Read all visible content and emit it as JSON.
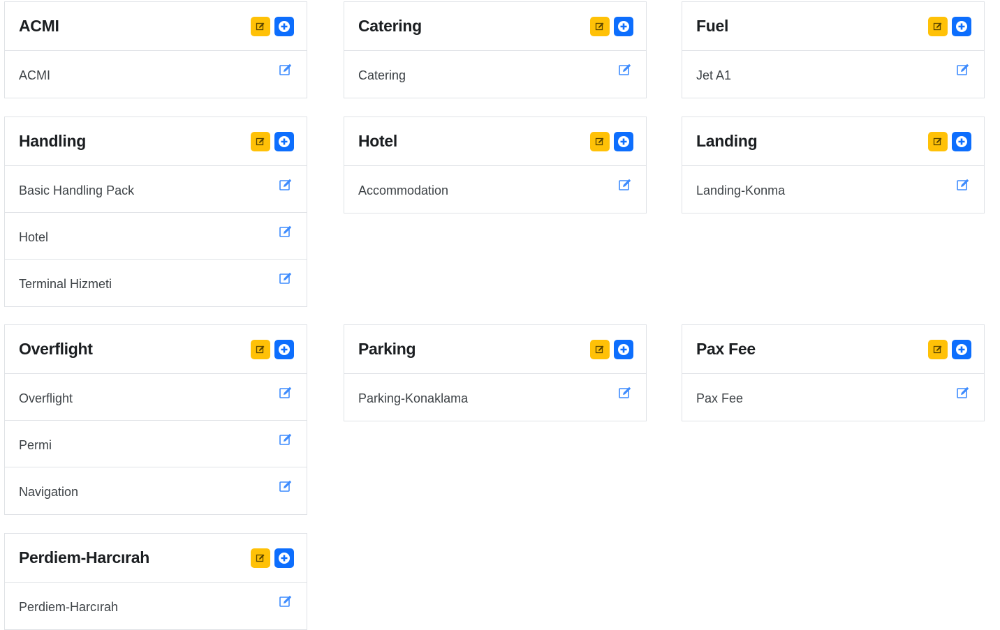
{
  "cards": [
    {
      "title": "ACMI",
      "items": [
        "ACMI"
      ]
    },
    {
      "title": "Catering",
      "items": [
        "Catering"
      ]
    },
    {
      "title": "Fuel",
      "items": [
        "Jet A1"
      ]
    },
    {
      "title": "Handling",
      "items": [
        "Basic Handling Pack",
        "Hotel",
        "Terminal Hizmeti"
      ]
    },
    {
      "title": "Hotel",
      "items": [
        "Accommodation"
      ]
    },
    {
      "title": "Landing",
      "items": [
        "Landing-Konma"
      ]
    },
    {
      "title": "Overflight",
      "items": [
        "Overflight",
        "Permi",
        "Navigation"
      ]
    },
    {
      "title": "Parking",
      "items": [
        "Parking-Konaklama"
      ]
    },
    {
      "title": "Pax Fee",
      "items": [
        "Pax Fee"
      ]
    },
    {
      "title": "Perdiem-Harcırah",
      "items": [
        "Perdiem-Harcırah"
      ]
    }
  ],
  "colors": {
    "edit_button": "#ffc107",
    "add_button": "#0d6efd",
    "row_edit_icon": "#3d8bfd"
  },
  "icons": {
    "header_edit": "edit-icon",
    "header_add": "plus-icon",
    "row_edit": "edit-icon"
  }
}
